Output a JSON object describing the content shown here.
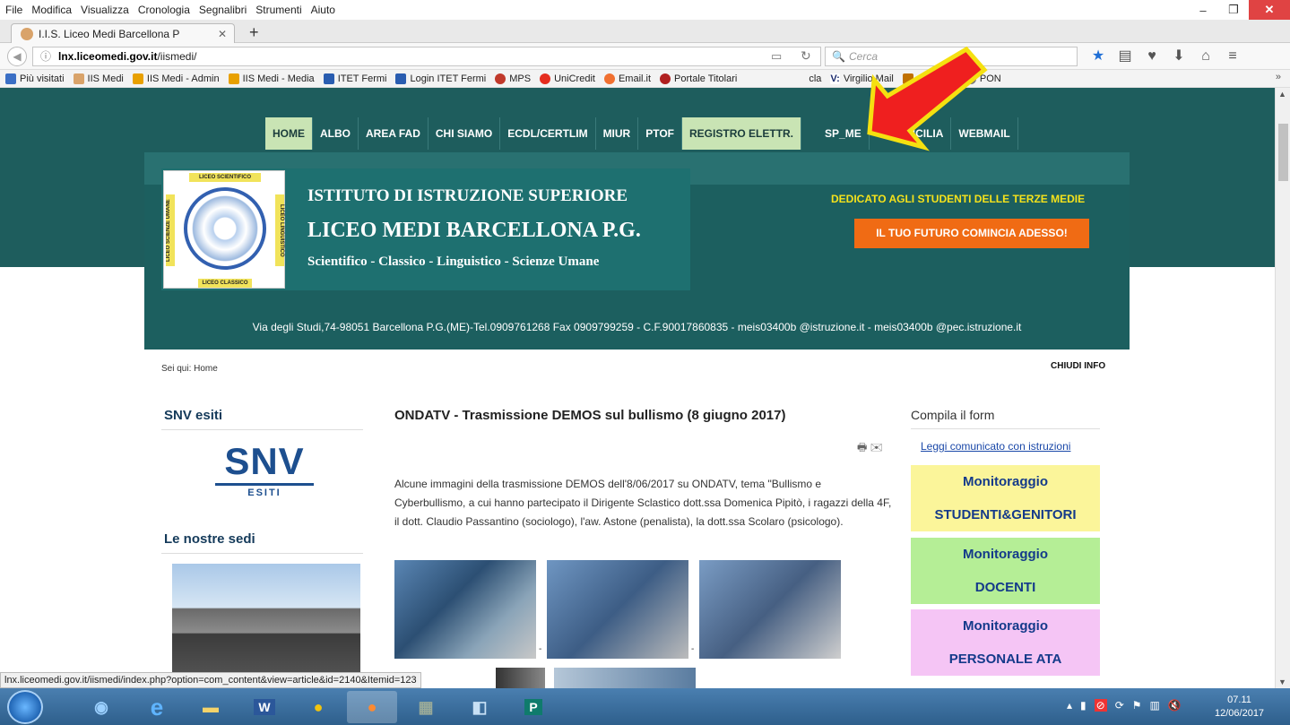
{
  "menu": [
    "File",
    "Modifica",
    "Visualizza",
    "Cronologia",
    "Segnalibri",
    "Strumenti",
    "Aiuto"
  ],
  "window_controls": {
    "minimize": "–",
    "maximize": "❐",
    "close": "✕"
  },
  "tab": {
    "title": "I.I.S. Liceo Medi Barcellona P",
    "close": "✕",
    "new": "+"
  },
  "url": {
    "host": "lnx.liceomedi.gov.it",
    "path": "/iismedi/",
    "info": "ⓘ"
  },
  "search": {
    "placeholder": "Cerca"
  },
  "bookmarks": [
    "Più visitati",
    "IIS Medi",
    "IIS Medi - Admin",
    "IIS Medi - Media",
    "ITET Fermi",
    "Login ITET Fermi",
    "MPS",
    "UniCredit",
    "Email.it",
    "Portale Titolari",
    "cla",
    "Virgilio Mail",
    "ADSicilia",
    "PON"
  ],
  "bookmarks_more": "»",
  "nav": {
    "home": "HOME",
    "albo": "ALBO",
    "fad": "AREA FAD",
    "chi": "CHI SIAMO",
    "ecdl": "ECDL/CERTLIM",
    "miur": "MIUR",
    "ptof": "PTOF",
    "reg": "REGISTRO ELETTR.",
    "usp": "SP_ME",
    "usr": "USR_SICILIA",
    "webmail": "WEBMAIL"
  },
  "header": {
    "line1": "ISTITUTO DI ISTRUZIONE SUPERIORE",
    "line2": "LICEO MEDI BARCELLONA P.G.",
    "line3": "Scientifico - Classico - Linguistico - Scienze Umane",
    "logo_top": "LICEO SCIENTIFICO",
    "logo_bottom": "LICEO CLASSICO",
    "logo_left": "LICEO SCIENZE UMANE",
    "logo_right": "LICEO LINGUISTICO",
    "dedicato": "DEDICATO AGLI STUDENTI DELLE TERZE MEDIE",
    "futuro": "IL TUO FUTURO COMINCIA ADESSO!",
    "address": "Via degli Studi,74-98051 Barcellona P.G.(ME)-Tel.0909761268 Fax 0909799259 - C.F.90017860835 - meis03400b @istruzione.it - meis03400b @pec.istruzione.it"
  },
  "breadcrumb": "Sei qui: Home",
  "chiudi": "CHIUDI INFO",
  "left": {
    "snv_title": "SNV esiti",
    "snv_big": "SNV",
    "snv_small": "ESITI",
    "sedi_title": "Le nostre sedi"
  },
  "article": {
    "title": "ONDATV - Trasmissione DEMOS sul bullismo (8 giugno 2017)",
    "text": "Alcune immagini della trasmissione DEMOS dell'8/06/2017 su ONDATV, tema \"Bullismo e Cyberbullismo, a cui hanno partecipato il Dirigente Sclastico dott.ssa Domenica Pipitò, i ragazzi della 4F, il dott. Claudio Passantino (sociologo), l'aw. Astone (penalista), la dott.ssa Scolaro (psicologo).",
    "dash": "-"
  },
  "right": {
    "compila": "Compila il form",
    "leggi": "Leggi comunicato con istruzioni",
    "m1a": "Monitoraggio",
    "m1b": "STUDENTI&GENITORI",
    "m2a": "Monitoraggio",
    "m2b": "DOCENTI",
    "m3a": "Monitoraggio",
    "m3b": "PERSONALE ATA"
  },
  "status_url": "lnx.liceomedi.gov.it/iismedi/index.php?option=com_content&view=article&id=2140&Itemid=123",
  "clock": {
    "time": "07.11",
    "date": "12/06/2017"
  }
}
